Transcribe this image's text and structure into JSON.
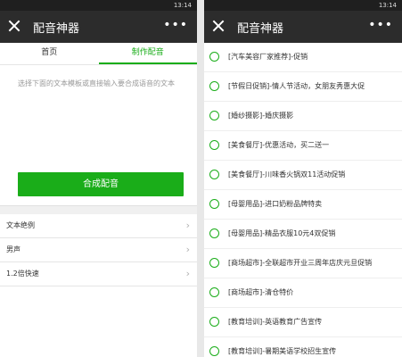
{
  "status_time": "13:14",
  "app_title": "配音神器",
  "tabs": [
    "首页",
    "制作配音"
  ],
  "hint": "选择下面的文本模板或直接输入要合成语音的文本",
  "synth_button": "合成配音",
  "settings": [
    "文本绝例",
    "男声",
    "1.2倍快速"
  ],
  "templates": [
    "[汽车美容厂家推荐]-促销",
    "[节假日促销]-情人节活动，女朋友秀惠大促",
    "[婚纱摄影]-婚庆摄影",
    "[美食餐厅]-优惠活动，买二送一",
    "[美食餐厅]-川味香火锅双11活动促销",
    "[母婴用品]-进口奶粉品牌特卖",
    "[母婴用品]-精品衣服10元4双促销",
    "[商场超市]-全联超市开业三周年店庆元旦促销",
    "[商场超市]-清仓特价",
    "[教育培训]-英语教育广告宣传",
    "[教育培训]-暑期美语学校招生宣传"
  ]
}
